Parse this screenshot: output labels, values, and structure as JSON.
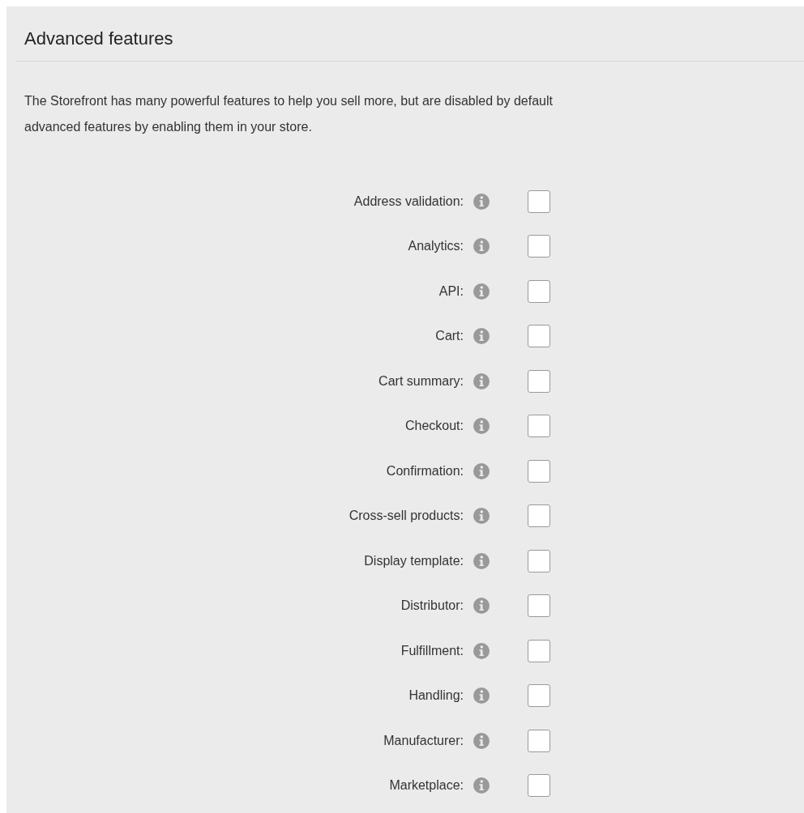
{
  "heading": "Advanced features",
  "intro": [
    "The Storefront has many powerful features to help you sell more, but are disabled by default",
    "advanced features by enabling them in your store."
  ],
  "features": [
    {
      "label": "Address validation:",
      "checked": false
    },
    {
      "label": "Analytics:",
      "checked": false
    },
    {
      "label": "API:",
      "checked": false
    },
    {
      "label": "Cart:",
      "checked": false
    },
    {
      "label": "Cart summary:",
      "checked": false
    },
    {
      "label": "Checkout:",
      "checked": false
    },
    {
      "label": "Confirmation:",
      "checked": false
    },
    {
      "label": "Cross-sell products:",
      "checked": false
    },
    {
      "label": "Display template:",
      "checked": false
    },
    {
      "label": "Distributor:",
      "checked": false
    },
    {
      "label": "Fulfillment:",
      "checked": false
    },
    {
      "label": "Handling:",
      "checked": false
    },
    {
      "label": "Manufacturer:",
      "checked": false
    },
    {
      "label": "Marketplace:",
      "checked": false
    }
  ]
}
